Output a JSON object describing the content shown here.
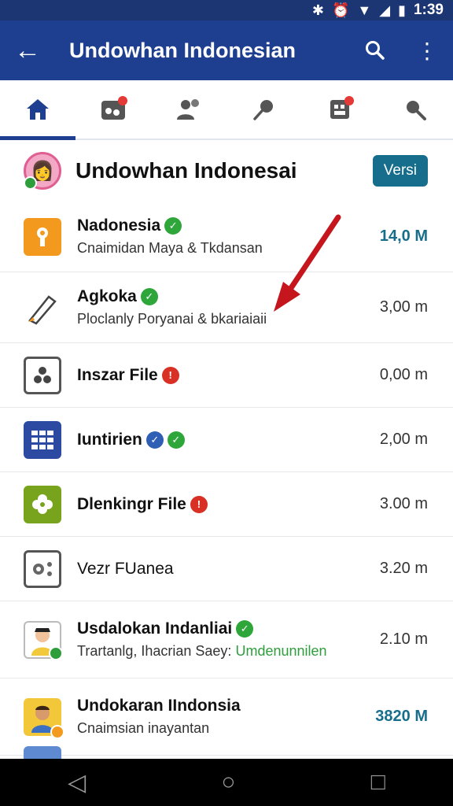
{
  "status_bar": {
    "time": "1:39",
    "icons": [
      "bluetooth-icon",
      "alarm-icon",
      "wifi-icon",
      "signal-icon",
      "battery-icon"
    ]
  },
  "app_bar": {
    "title": "Undowhan Indonesian",
    "icons": [
      "back-arrow-icon",
      "search-icon",
      "more-vert-icon"
    ]
  },
  "tabs": [
    {
      "icon": "home-icon",
      "active": true,
      "dot": false
    },
    {
      "icon": "gallery-icon",
      "active": false,
      "dot": true
    },
    {
      "icon": "people-icon",
      "active": false,
      "dot": false
    },
    {
      "icon": "pin-icon",
      "active": false,
      "dot": false
    },
    {
      "icon": "calendar-icon",
      "active": false,
      "dot": true
    },
    {
      "icon": "search-icon",
      "active": false,
      "dot": false
    }
  ],
  "header": {
    "title": "Undowhan Indonesai",
    "button": "Versi"
  },
  "rows": [
    {
      "name": "Nadonesia",
      "sub": "Cnaimidan Maya & Tkdansan",
      "size": "14,0 M",
      "accent": true,
      "icon": "keyhole-icon",
      "color": "#f39a1e",
      "badge": "green"
    },
    {
      "name": "Agkoka",
      "sub": "Ploclanly Poryanai & bkariaiaii",
      "size": "3,00 m",
      "accent": false,
      "icon": "pen-icon",
      "color": "#ffffff",
      "badge": "green"
    },
    {
      "name": "Inszar File",
      "sub": "",
      "size": "0,00 m",
      "accent": false,
      "icon": "dice-icon",
      "color": "#ffffff",
      "badge": "red"
    },
    {
      "name": "Iuntirien",
      "sub": "",
      "size": "2,00 m",
      "accent": false,
      "icon": "grid-icon",
      "color": "#2c4aa2",
      "badge": "blue-green"
    },
    {
      "name": "Dlenkingr File",
      "sub": "",
      "size": "3.00 m",
      "accent": false,
      "icon": "flower-icon",
      "color": "#78a31c",
      "badge": "red"
    },
    {
      "name": "Vezr FUanea",
      "sub": "",
      "size": "3.20 m",
      "accent": false,
      "icon": "settings-icon",
      "color": "#ffffff",
      "badge": ""
    },
    {
      "name": "Usdalokan Indanliai",
      "sub": "Trartanlg, Ihacrian Saey:",
      "sub_green": "Umdenunnilen",
      "size": "2.10 m",
      "accent": false,
      "icon": "person-icon",
      "color": "#ffffff",
      "badge": "green"
    },
    {
      "name": "Undokaran IIndonsia",
      "sub": "Cnaimsian inayantan",
      "size": "3820 M",
      "accent": true,
      "icon": "person-icon",
      "color": "#f3c73a",
      "badge": ""
    }
  ]
}
